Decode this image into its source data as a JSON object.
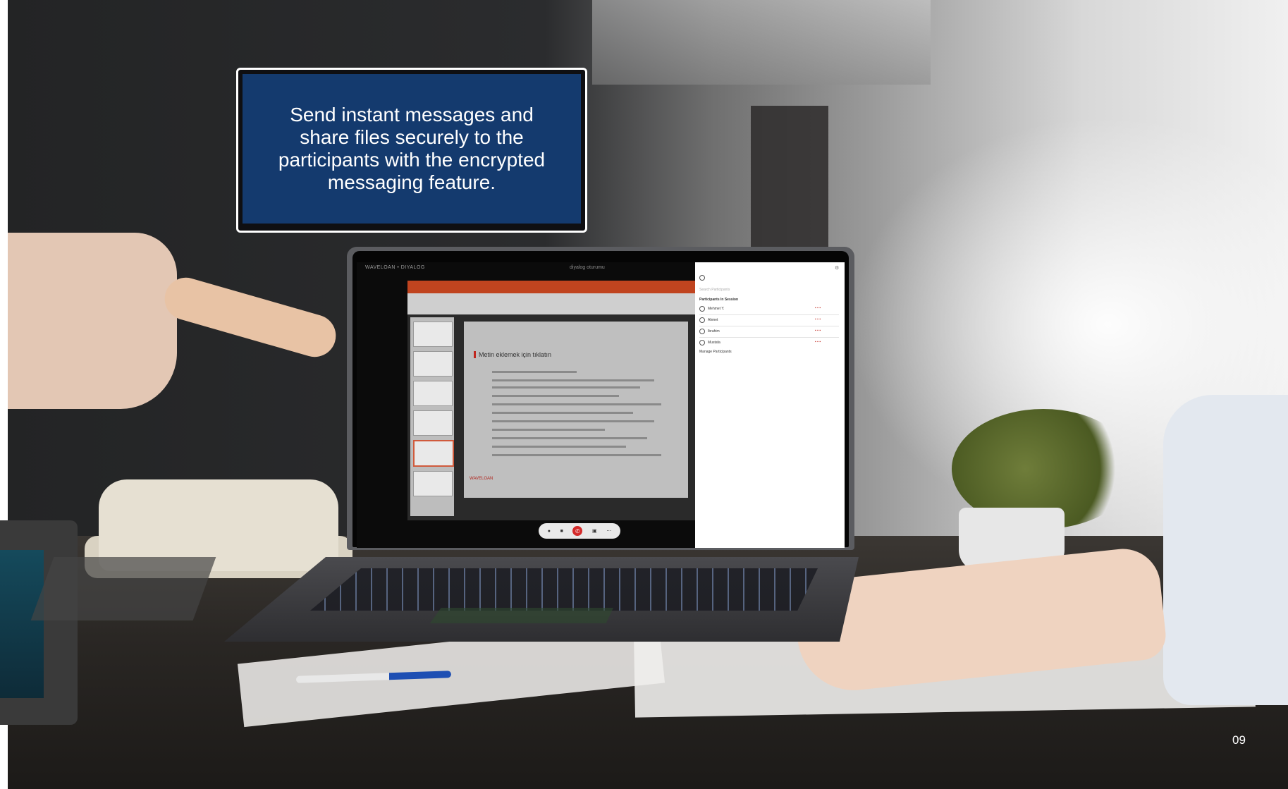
{
  "caption": {
    "text": "Send instant messages and share files securely to the participants with the encrypted messaging feature."
  },
  "page_number": "09",
  "screen": {
    "brand": "WAVELOAN • DIYALOG",
    "meeting_title": "diyalog oturumu",
    "slide_title": "Metin eklemek için tıklatın",
    "slide_logo": "WAVELOAN",
    "participants_panel": {
      "search_placeholder": "Search Participants",
      "section_title": "Participants In Session",
      "participants": [
        {
          "name": "Mehmet Y."
        },
        {
          "name": "Ahmet"
        },
        {
          "name": "Ibrahim"
        },
        {
          "name": "Mustafa"
        }
      ],
      "footer": "Manage Participants"
    }
  },
  "colors": {
    "caption_fill": "#143a6e",
    "caption_border": "#ffffff",
    "end_call": "#d42a2a",
    "ppt_ribbon": "#c0441f"
  }
}
